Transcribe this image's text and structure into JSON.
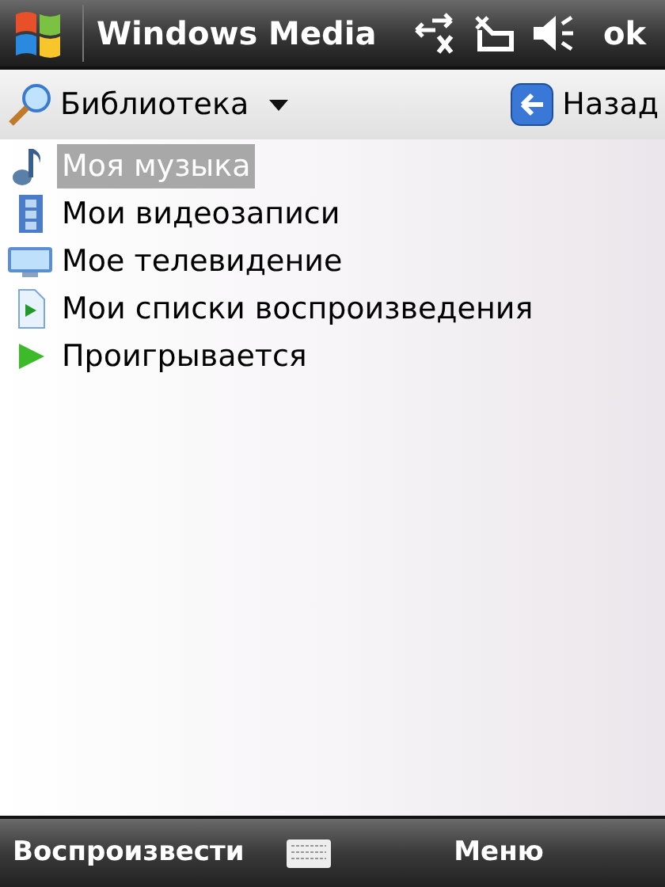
{
  "title_bar": {
    "title": "Windows Media",
    "ok": "ok"
  },
  "toolbar": {
    "library": "Библиотека",
    "back": "Назад"
  },
  "items": [
    {
      "label": "Моя музыка",
      "kind": "music",
      "selected": true
    },
    {
      "label": "Мои видеозаписи",
      "kind": "video",
      "selected": false
    },
    {
      "label": "Мое телевидение",
      "kind": "tv",
      "selected": false
    },
    {
      "label": "Мои списки воспроизведения",
      "kind": "playlist",
      "selected": false
    },
    {
      "label": "Проигрывается",
      "kind": "playing",
      "selected": false
    }
  ],
  "softkeys": {
    "left": "Воспроизвести",
    "right": "Меню"
  }
}
